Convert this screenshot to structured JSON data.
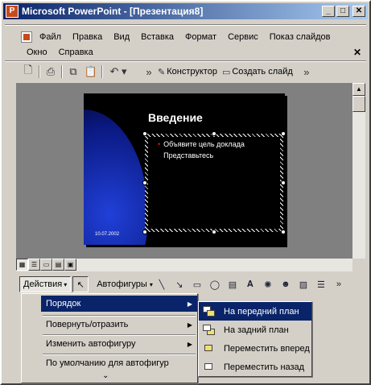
{
  "window": {
    "title": "Microsoft PowerPoint - [Презентация8]",
    "minimize_glyph": "_",
    "maximize_glyph": "□",
    "close_glyph": "✕"
  },
  "menubar": {
    "items": [
      "Файл",
      "Правка",
      "Вид",
      "Вставка",
      "Формат",
      "Сервис",
      "Показ слайдов"
    ],
    "row2": [
      "Окно",
      "Справка"
    ],
    "close_glyph": "✕"
  },
  "toolbar": {
    "designer_label": "Конструктор",
    "new_slide_label": "Создать слайд",
    "more_glyph": "»"
  },
  "slide": {
    "title": "Введение",
    "bullets": [
      "Объявите цель доклада",
      "Представьтесь"
    ],
    "date": "10.07.2002",
    "colors": {
      "background": "#000000",
      "accent": "#2040d8",
      "bullet": "#c02020"
    }
  },
  "drawbar": {
    "actions_label": "Действия",
    "autoshapes_label": "Автофигуры"
  },
  "actions_menu": {
    "items": [
      {
        "label": "Порядок",
        "has_submenu": true,
        "highlighted": true
      },
      {
        "label": "Повернуть/отразить",
        "has_submenu": true,
        "highlighted": false
      },
      {
        "label": "Изменить автофигуру",
        "has_submenu": true,
        "highlighted": false
      },
      {
        "label": "По умолчанию для автофигур",
        "has_submenu": false,
        "highlighted": false
      }
    ],
    "more_glyph": "⌄"
  },
  "order_submenu": {
    "items": [
      {
        "label": "На передний план",
        "icon": "bring-to-front-icon",
        "highlighted": true
      },
      {
        "label": "На задний план",
        "icon": "send-to-back-icon",
        "highlighted": false
      },
      {
        "label": "Переместить вперед",
        "icon": "bring-forward-icon",
        "highlighted": false
      },
      {
        "label": "Переместить назад",
        "icon": "send-backward-icon",
        "highlighted": false
      }
    ]
  }
}
